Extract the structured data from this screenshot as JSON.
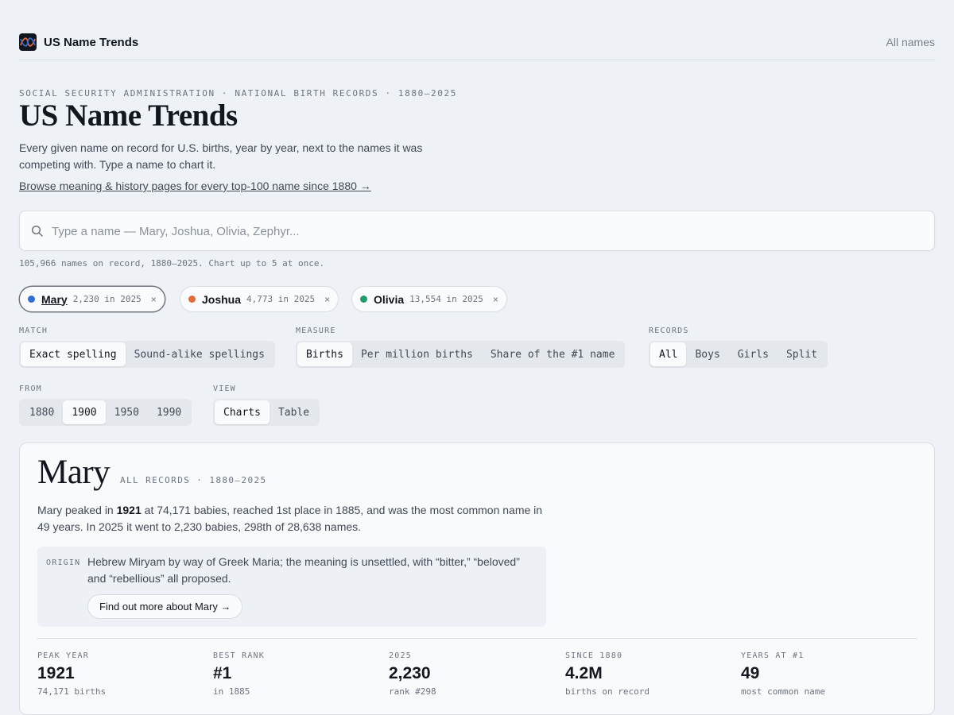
{
  "header": {
    "brand": "US Name Trends",
    "nav_link": "All names"
  },
  "hero": {
    "eyebrow": "SOCIAL SECURITY ADMINISTRATION · NATIONAL BIRTH RECORDS · 1880–2025",
    "title": "US Name Trends",
    "description": "Every given name on record for U.S. births, year by year, next to the names it was competing with. Type a name to chart it.",
    "browse_link": "Browse meaning & history pages for every top-100 name since 1880 →"
  },
  "search": {
    "placeholder": "Type a name — Mary, Joshua, Olivia, Zephyr...",
    "value": "",
    "hint": "105,966 names on record, 1880–2025. Chart up to 5 at once."
  },
  "chips": [
    {
      "name": "Mary",
      "count": "2,230 in 2025",
      "color": "#2f6fd1",
      "close": "×",
      "active": true
    },
    {
      "name": "Joshua",
      "count": "4,773 in 2025",
      "color": "#e8693a",
      "close": "×",
      "active": false
    },
    {
      "name": "Olivia",
      "count": "13,554 in 2025",
      "color": "#1f9e6a",
      "close": "×",
      "active": false
    }
  ],
  "controls": {
    "match": {
      "label": "MATCH",
      "options": [
        "Exact spelling",
        "Sound-alike spellings"
      ],
      "selected": "Exact spelling"
    },
    "measure": {
      "label": "MEASURE",
      "options": [
        "Births",
        "Per million births",
        "Share of the #1 name"
      ],
      "selected": "Births"
    },
    "records": {
      "label": "RECORDS",
      "options": [
        "All",
        "Boys",
        "Girls",
        "Split"
      ],
      "selected": "All"
    },
    "from": {
      "label": "FROM",
      "options": [
        "1880",
        "1900",
        "1950",
        "1990"
      ],
      "selected": "1900"
    },
    "view": {
      "label": "VIEW",
      "options": [
        "Charts",
        "Table"
      ],
      "selected": "Charts"
    }
  },
  "card": {
    "name": "Mary",
    "subtitle": "ALL RECORDS · 1880–2025",
    "summary": {
      "p1": "Mary peaked in ",
      "peak_year": "1921",
      "p2": " at 74,171 babies, reached 1st place in 1885, and was the most common name in 49 years. In 2025 it went to 2,230 babies, 298th of 28,638 names."
    },
    "origin": {
      "label": "ORIGIN",
      "text": "Hebrew Miryam by way of Greek Maria; the meaning is unsettled, with “bitter,” “beloved” and “rebellious” all proposed.",
      "button": "Find out more about Mary →"
    },
    "stats": [
      {
        "label": "PEAK YEAR",
        "value": "1921",
        "note": "74,171 births"
      },
      {
        "label": "BEST RANK",
        "value": "#1",
        "note": "in 1885"
      },
      {
        "label": "2025",
        "value": "2,230",
        "note": "rank #298"
      },
      {
        "label": "SINCE 1880",
        "value": "4.2M",
        "note": "births on record"
      },
      {
        "label": "YEARS AT #1",
        "value": "49",
        "note": "most common name"
      }
    ]
  }
}
